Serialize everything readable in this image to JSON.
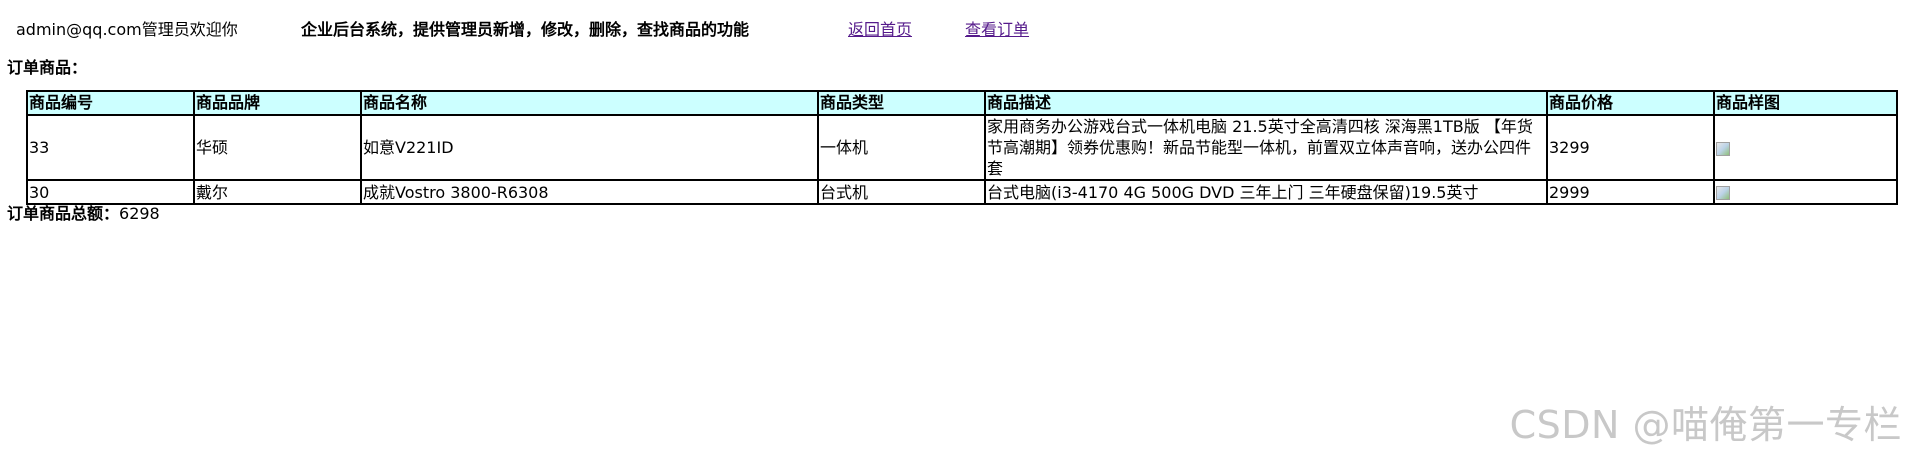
{
  "header": {
    "user_greeting": "admin@qq.com管理员欢迎你",
    "system_desc": "企业后台系统，提供管理员新增，修改，删除，查找商品的功能",
    "home_link": "返回首页",
    "orders_link": "查看订单"
  },
  "section": {
    "title": "订单商品："
  },
  "table": {
    "columns": [
      "商品编号",
      "商品品牌",
      "商品名称",
      "商品类型",
      "商品描述",
      "商品价格",
      "商品样图"
    ],
    "rows": [
      {
        "id": "33",
        "brand": "华硕",
        "name": "如意V221ID",
        "type": "一体机",
        "desc": "家用商务办公游戏台式一体机电脑 21.5英寸全高清四核 深海黑1TB版 【年货节高潮期】领券优惠购！新品节能型一体机，前置双立体声音响，送办公四件套",
        "price": "3299",
        "image": "broken-image-icon"
      },
      {
        "id": "30",
        "brand": "戴尔",
        "name": "成就Vostro 3800-R6308",
        "type": "台式机",
        "desc": "台式电脑(i3-4170 4G 500G DVD 三年上门 三年硬盘保留)19.5英寸",
        "price": "2999",
        "image": "broken-image-icon"
      }
    ]
  },
  "total": {
    "label": "订单商品总额：",
    "value": "6298"
  },
  "watermark": "CSDN @喵俺第一专栏",
  "colors": {
    "header_bg": "#ccffff",
    "link": "#551a8b",
    "watermark": "#c8c8c8"
  }
}
